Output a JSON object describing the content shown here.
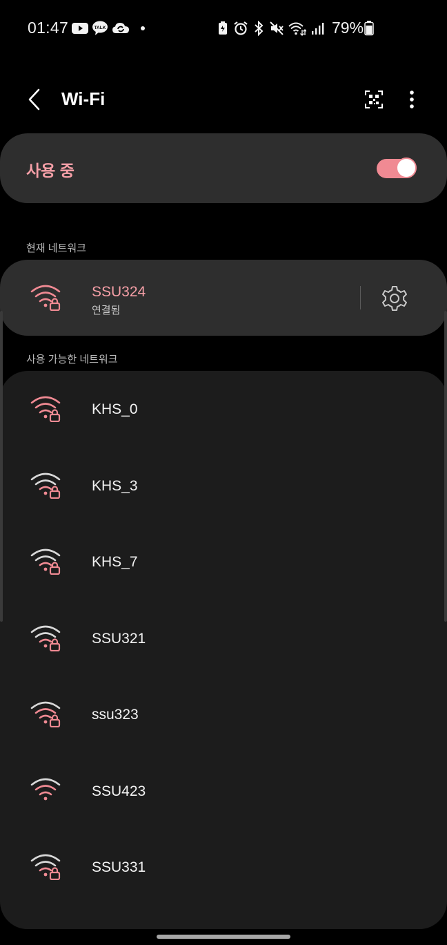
{
  "status_bar": {
    "time": "01:47",
    "battery": "79%",
    "left_icons": [
      "youtube-icon",
      "talk-icon",
      "cloud-sync-icon",
      "dot-icon"
    ],
    "right_icons": [
      "battery-saver-icon",
      "alarm-icon",
      "bluetooth-icon",
      "mute-icon",
      "wifi-status-icon",
      "signal-icon"
    ]
  },
  "header": {
    "title": "Wi-Fi"
  },
  "master_toggle": {
    "label": "사용 중",
    "on": true
  },
  "current_section_label": "현재 네트워크",
  "current_network": {
    "name": "SSU324",
    "status": "연결됨"
  },
  "available_section_label": "사용 가능한 네트워크",
  "available_networks": [
    {
      "name": "KHS_0",
      "secured": true,
      "signal": 4
    },
    {
      "name": "KHS_3",
      "secured": true,
      "signal": 2
    },
    {
      "name": "KHS_7",
      "secured": true,
      "signal": 2
    },
    {
      "name": "SSU321",
      "secured": true,
      "signal": 2
    },
    {
      "name": "ssu323",
      "secured": true,
      "signal": 3
    },
    {
      "name": "SSU423",
      "secured": false,
      "signal": 3
    },
    {
      "name": "SSU331",
      "secured": true,
      "signal": 2
    }
  ],
  "colors": {
    "accent": "#f08a93",
    "card": "#2e2e2e",
    "list_card": "#1c1c1c",
    "background": "#000000"
  }
}
